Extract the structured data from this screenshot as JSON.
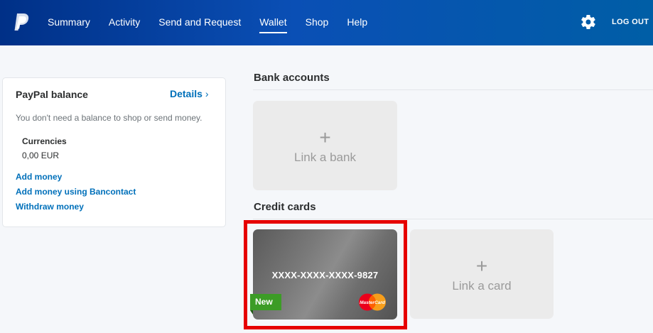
{
  "header": {
    "nav": [
      "Summary",
      "Activity",
      "Send and Request",
      "Wallet",
      "Shop",
      "Help"
    ],
    "active_nav": "Wallet",
    "logout_label": "LOG OUT"
  },
  "balance": {
    "title": "PayPal balance",
    "details_label": "Details",
    "description": "You don't need a balance to shop or send money.",
    "currencies_title": "Currencies",
    "currency_value": "0,00 EUR",
    "links": [
      "Add money",
      "Add money using Bancontact",
      "Withdraw money"
    ]
  },
  "bank_accounts": {
    "title": "Bank accounts",
    "link_label": "Link a bank",
    "plus": "+"
  },
  "credit_cards": {
    "title": "Credit cards",
    "card_number": "XXXX-XXXX-XXXX-9827",
    "badge": "New",
    "card_brand": "MasterCard",
    "link_label": "Link a card",
    "plus": "+"
  },
  "colors": {
    "header_start": "#003087",
    "header_end": "#005ea6",
    "link": "#0070ba",
    "highlight": "#e60000",
    "badge_new": "#3c9c26"
  }
}
